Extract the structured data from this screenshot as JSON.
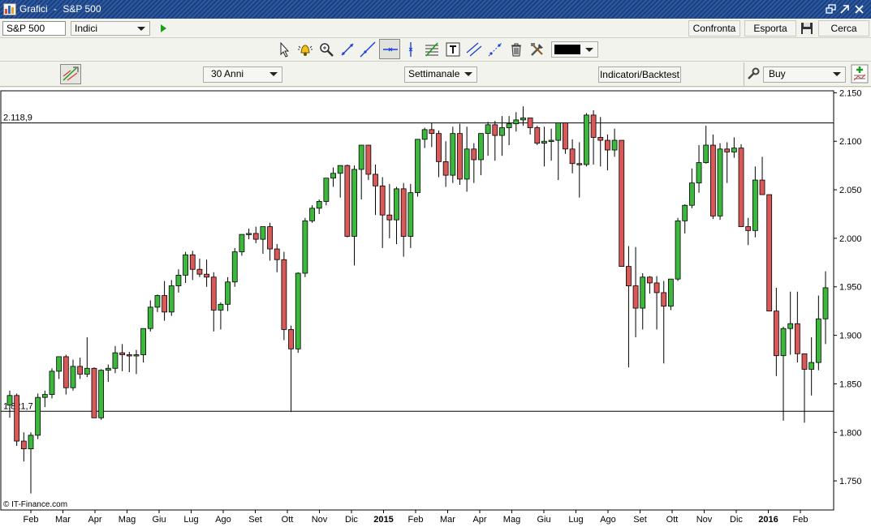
{
  "window": {
    "app": "Grafici",
    "separator": "-",
    "instrument": "S&P 500"
  },
  "toolbar": {
    "symbol_value": "S&P 500",
    "market_select": "Indici",
    "compare_label": "Confronta",
    "export_label": "Esporta",
    "search_label": "Cerca",
    "color_swatch": "#000000"
  },
  "settings": {
    "range_select": "30 Anni",
    "interval_select": "Settimanale",
    "indicators_label": "Indicatori/Backtest",
    "strategy_select": "Buy"
  },
  "chart": {
    "watermark": "© IT-Finance.com",
    "hline_labels": [
      "2.118,9",
      "1.821,7"
    ],
    "up_color": "#3cb93c",
    "down_color": "#d95858"
  },
  "chart_data": {
    "type": "candlestick",
    "y_ticks": [
      "2.150",
      "2.100",
      "2.050",
      "2.000",
      "1.950",
      "1.900",
      "1.850",
      "1.800",
      "1.750"
    ],
    "ylim": [
      1720,
      2152
    ],
    "x_tick_labels": [
      "Feb",
      "Mar",
      "Apr",
      "Mag",
      "Giu",
      "Lug",
      "Ago",
      "Set",
      "Ott",
      "Nov",
      "Dic",
      "2015",
      "Feb",
      "Mar",
      "Apr",
      "Mag",
      "Giu",
      "Lug",
      "Ago",
      "Set",
      "Ott",
      "Nov",
      "Dic",
      "2016",
      "Feb"
    ],
    "bold_x_labels": [
      "2015",
      "2016"
    ],
    "horizontal_lines": [
      2118.9,
      1821.7
    ],
    "candles": [
      [
        1828,
        1843,
        1815,
        1838
      ],
      [
        1838,
        1840,
        1786,
        1791
      ],
      [
        1791,
        1800,
        1770,
        1783
      ],
      [
        1783,
        1800,
        1737,
        1797
      ],
      [
        1797,
        1840,
        1793,
        1836
      ],
      [
        1836,
        1843,
        1826,
        1839
      ],
      [
        1839,
        1866,
        1835,
        1863
      ],
      [
        1863,
        1877,
        1855,
        1878
      ],
      [
        1878,
        1880,
        1839,
        1846
      ],
      [
        1846,
        1875,
        1843,
        1868
      ],
      [
        1868,
        1877,
        1855,
        1860
      ],
      [
        1860,
        1898,
        1857,
        1866
      ],
      [
        1866,
        1867,
        1815,
        1815
      ],
      [
        1815,
        1865,
        1813,
        1864
      ],
      [
        1864,
        1870,
        1852,
        1866
      ],
      [
        1866,
        1889,
        1861,
        1882
      ],
      [
        1882,
        1891,
        1863,
        1880
      ],
      [
        1880,
        1883,
        1862,
        1879
      ],
      [
        1879,
        1885,
        1860,
        1880
      ],
      [
        1880,
        1907,
        1872,
        1907
      ],
      [
        1907,
        1936,
        1904,
        1929
      ],
      [
        1929,
        1942,
        1924,
        1941
      ],
      [
        1941,
        1956,
        1915,
        1924
      ],
      [
        1924,
        1957,
        1920,
        1951
      ],
      [
        1951,
        1968,
        1944,
        1962
      ],
      [
        1962,
        1986,
        1954,
        1983
      ],
      [
        1983,
        1987,
        1957,
        1968
      ],
      [
        1968,
        1979,
        1960,
        1963
      ],
      [
        1963,
        1978,
        1950,
        1960
      ],
      [
        1960,
        1965,
        1904,
        1926
      ],
      [
        1926,
        1934,
        1906,
        1932
      ],
      [
        1932,
        1960,
        1925,
        1955
      ],
      [
        1955,
        1990,
        1950,
        1986
      ],
      [
        1986,
        2001,
        1982,
        2004
      ],
      [
        2004,
        2010,
        1999,
        2005
      ],
      [
        2005,
        2012,
        1995,
        1999
      ],
      [
        1999,
        2007,
        1984,
        2012
      ],
      [
        2012,
        2016,
        1977,
        1989
      ],
      [
        1989,
        1994,
        1965,
        1978
      ],
      [
        1978,
        1986,
        1895,
        1906
      ],
      [
        1906,
        1910,
        1821,
        1886
      ],
      [
        1886,
        1965,
        1882,
        1964
      ],
      [
        1964,
        2021,
        1960,
        2018
      ],
      [
        2018,
        2034,
        2016,
        2031
      ],
      [
        2031,
        2040,
        2025,
        2038
      ],
      [
        2038,
        2058,
        2034,
        2062
      ],
      [
        2062,
        2073,
        2053,
        2067
      ],
      [
        2067,
        2072,
        2042,
        2075
      ],
      [
        2075,
        2076,
        2001,
        2002
      ],
      [
        2002,
        2075,
        1972,
        2071
      ],
      [
        2071,
        2087,
        2040,
        2096
      ],
      [
        2096,
        2093,
        2060,
        2066
      ],
      [
        2066,
        2076,
        2024,
        2054
      ],
      [
        2054,
        2063,
        1990,
        2024
      ],
      [
        2024,
        2056,
        2000,
        2019
      ],
      [
        2019,
        2053,
        1994,
        2051
      ],
      [
        2051,
        2057,
        1981,
        2002
      ],
      [
        2002,
        2056,
        1990,
        2047
      ],
      [
        2047,
        2096,
        2043,
        2102
      ],
      [
        2102,
        2114,
        2093,
        2112
      ],
      [
        2112,
        2119,
        2094,
        2108
      ],
      [
        2108,
        2111,
        2063,
        2079
      ],
      [
        2079,
        2100,
        2053,
        2065
      ],
      [
        2065,
        2115,
        2057,
        2108
      ],
      [
        2108,
        2118,
        2055,
        2061
      ],
      [
        2061,
        2115,
        2048,
        2092
      ],
      [
        2092,
        2098,
        2057,
        2081
      ],
      [
        2081,
        2099,
        2065,
        2108
      ],
      [
        2108,
        2120,
        2085,
        2117
      ],
      [
        2117,
        2121,
        2080,
        2106
      ],
      [
        2106,
        2126,
        2085,
        2114
      ],
      [
        2114,
        2126,
        2096,
        2118
      ],
      [
        2118,
        2130,
        2110,
        2122
      ],
      [
        2122,
        2136,
        2116,
        2124
      ],
      [
        2124,
        2119,
        2107,
        2114
      ],
      [
        2114,
        2116,
        2096,
        2098
      ],
      [
        2098,
        2115,
        2074,
        2100
      ],
      [
        2100,
        2113,
        2080,
        2101
      ],
      [
        2101,
        2119,
        2060,
        2119
      ],
      [
        2119,
        2117,
        2087,
        2092
      ],
      [
        2092,
        2102,
        2067,
        2077
      ],
      [
        2077,
        2099,
        2042,
        2076
      ],
      [
        2076,
        2129,
        2074,
        2127
      ],
      [
        2127,
        2132,
        2076,
        2104
      ],
      [
        2104,
        2125,
        2074,
        2101
      ],
      [
        2101,
        2107,
        2070,
        2091
      ],
      [
        2091,
        2113,
        2084,
        2101
      ],
      [
        2101,
        2098,
        2043,
        1971
      ],
      [
        1971,
        1992,
        1867,
        1951
      ],
      [
        1951,
        1991,
        1898,
        1928
      ],
      [
        1928,
        1964,
        1906,
        1960
      ],
      [
        1960,
        1961,
        1943,
        1954
      ],
      [
        1954,
        1961,
        1906,
        1944
      ],
      [
        1944,
        1956,
        1871,
        1930
      ],
      [
        1930,
        1957,
        1926,
        1958
      ],
      [
        1958,
        2021,
        1956,
        2018
      ],
      [
        2018,
        2035,
        2005,
        2034
      ],
      [
        2034,
        2072,
        2031,
        2057
      ],
      [
        2057,
        2096,
        2047,
        2078
      ],
      [
        2078,
        2116,
        2077,
        2096
      ],
      [
        2096,
        2107,
        2020,
        2023
      ],
      [
        2023,
        2098,
        2019,
        2092
      ],
      [
        2092,
        2099,
        2057,
        2089
      ],
      [
        2089,
        2104,
        2083,
        2093
      ],
      [
        2093,
        2097,
        2022,
        2012
      ],
      [
        2012,
        2021,
        1993,
        2008
      ],
      [
        2008,
        2074,
        2001,
        2060
      ],
      [
        2060,
        2084,
        2054,
        2045
      ],
      [
        2045,
        2038,
        1940,
        1925
      ],
      [
        1925,
        1949,
        1858,
        1879
      ],
      [
        1879,
        1909,
        1812,
        1907
      ],
      [
        1907,
        1945,
        1880,
        1912
      ],
      [
        1912,
        1945,
        1872,
        1881
      ],
      [
        1881,
        1870,
        1810,
        1865
      ],
      [
        1865,
        1898,
        1838,
        1872
      ],
      [
        1872,
        1941,
        1864,
        1917
      ],
      [
        1917,
        1966,
        1891,
        1949
      ]
    ]
  }
}
